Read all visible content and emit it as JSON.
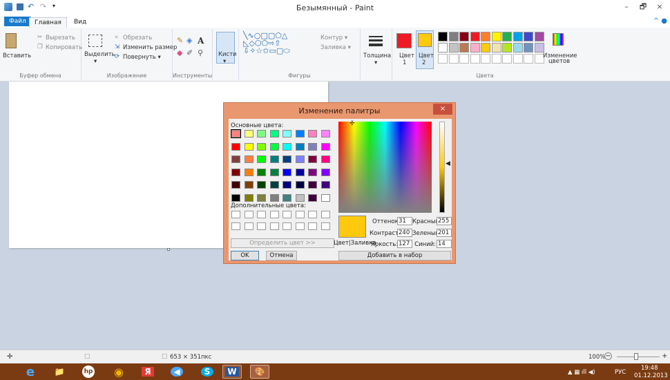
{
  "window": {
    "title": "Безымянный - Paint",
    "minimize": "–",
    "maximize": "🗗",
    "close": "×"
  },
  "tabs": {
    "file": "Файл",
    "home": "Главная",
    "view": "Вид"
  },
  "ribbon": {
    "clipboard": {
      "paste": "Вставить",
      "cut": "Вырезать",
      "copy": "Копировать",
      "label": "Буфер обмена"
    },
    "image": {
      "select": "Выделить",
      "crop": "Обрезать",
      "resize": "Изменить размер",
      "rotate": "Повернуть ▾",
      "label": "Изображение"
    },
    "tools": {
      "label": "Инструменты",
      "text_tool": "A"
    },
    "brushes": {
      "label": "Кисти"
    },
    "shapes": {
      "outline": "Контур ▾",
      "fill": "Заливка ▾",
      "label": "Фигуры"
    },
    "size": {
      "label": "Толщина"
    },
    "colors": {
      "color1": "Цвет",
      "color1_num": "1",
      "color2": "Цвет",
      "color2_num": "2",
      "edit": "Изменение",
      "edit2": "цветов",
      "label": "Цвета",
      "color1_value": "#ed1c24",
      "color2_value": "#ffc90e"
    }
  },
  "palette_row1": [
    "#000000",
    "#7f7f7f",
    "#880015",
    "#ed1c24",
    "#ff7f27",
    "#fff200",
    "#22b14c",
    "#00a2e8",
    "#3f48cc",
    "#a349a4"
  ],
  "palette_row2": [
    "#ffffff",
    "#c3c3c3",
    "#b97a57",
    "#ffaec9",
    "#ffc90e",
    "#efe4b0",
    "#b5e61d",
    "#99d9ea",
    "#7092be",
    "#c8bfe7"
  ],
  "status": {
    "size": "653 × 351пкс",
    "zoom": "100%",
    "zoom_minus": "−",
    "zoom_plus": "+"
  },
  "taskbar": {
    "lang": "РУС",
    "time": "19:48",
    "date": "01.12.2013",
    "apps": [
      "e",
      "📁",
      "hp",
      "◉",
      "Я",
      "◀",
      "S",
      "W",
      "🎨"
    ]
  },
  "dialog": {
    "title": "Изменение палитры",
    "close": "×",
    "basic_colors": "Основные цвета:",
    "custom_colors": "Дополнительные цвета:",
    "define": "Определить цвет >>",
    "ok": "OK",
    "cancel": "Отмена",
    "color_fill": "Цвет|Заливка",
    "add": "Добавить в набор",
    "hue_label": "Оттенок:",
    "hue": "31",
    "sat_label": "Контраст:",
    "sat": "240",
    "lum_label": "Яркость:",
    "lum": "127",
    "red_label": "Красный:",
    "red": "255",
    "green_label": "Зеленый:",
    "green": "201",
    "blue_label": "Синий:",
    "blue": "14",
    "current_color": "#ffc90e",
    "basic_swatches": [
      [
        "#ff8080",
        "#ffff80",
        "#80ff80",
        "#00ff80",
        "#80ffff",
        "#0080ff",
        "#ff80c0",
        "#ff80ff"
      ],
      [
        "#ff0000",
        "#ffff00",
        "#80ff00",
        "#00ff40",
        "#00ffff",
        "#0080c0",
        "#8080c0",
        "#ff00ff"
      ],
      [
        "#804040",
        "#ff8040",
        "#00ff00",
        "#008080",
        "#004080",
        "#8080ff",
        "#800040",
        "#ff0080"
      ],
      [
        "#800000",
        "#ff8000",
        "#008000",
        "#008040",
        "#0000ff",
        "#0000a0",
        "#800080",
        "#8000ff"
      ],
      [
        "#400000",
        "#804000",
        "#004000",
        "#004040",
        "#000080",
        "#000040",
        "#400040",
        "#400080"
      ],
      [
        "#000000",
        "#808000",
        "#808040",
        "#808080",
        "#408080",
        "#c0c0c0",
        "#400040",
        "#ffffff"
      ]
    ]
  }
}
